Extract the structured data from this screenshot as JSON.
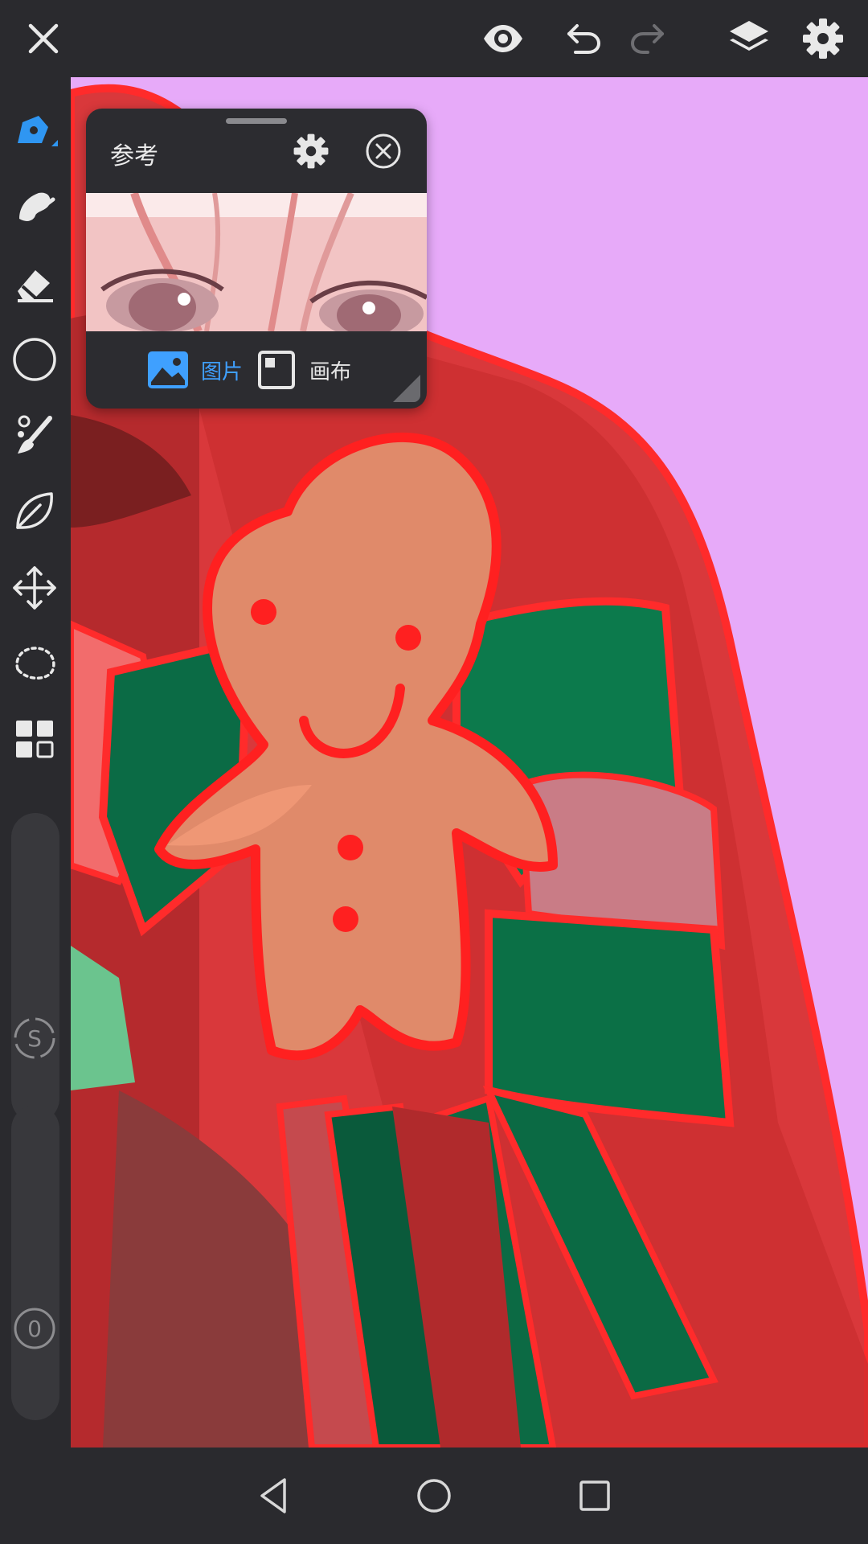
{
  "topbar": {
    "close_icon": "close-icon",
    "preview_icon": "eye-icon",
    "undo_icon": "undo-icon",
    "redo_icon": "redo-icon",
    "layers_icon": "layers-icon",
    "settings_icon": "gear-icon"
  },
  "toolbar": {
    "tools": [
      "pen-tool",
      "smudge-tool",
      "eraser-tool",
      "shape-tool",
      "brush-tool",
      "fill-tool",
      "transform-tool",
      "lasso-tool",
      "filter-tool"
    ],
    "accent_color": "#2f96f2",
    "size_badge": "S",
    "opacity_badge": "0"
  },
  "reference_panel": {
    "title": "参考",
    "tab_image": "图片",
    "tab_canvas": "画布",
    "active_tab": "image",
    "active_color": "#3fa0ff"
  },
  "navbar": {
    "back_icon": "back-triangle-icon",
    "home_icon": "home-circle-icon",
    "recents_icon": "recents-square-icon"
  },
  "canvas": {
    "background_color": "#e7aaf9"
  }
}
